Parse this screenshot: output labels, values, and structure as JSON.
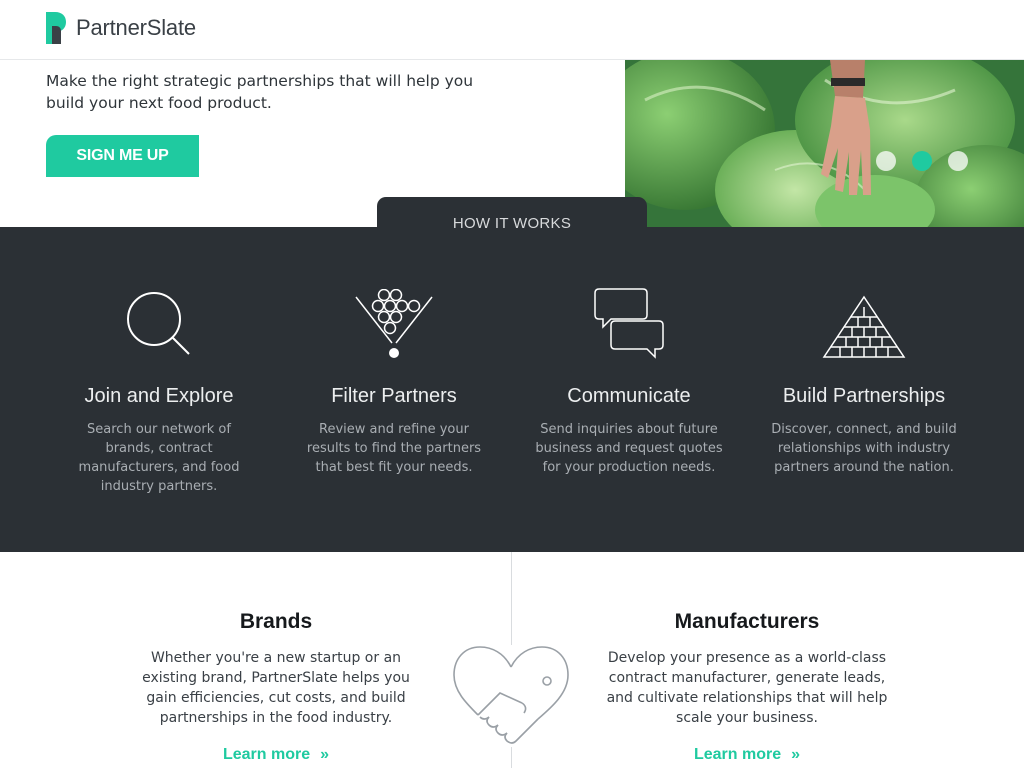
{
  "header": {
    "logo_text": "PartnerSlate"
  },
  "hero": {
    "tagline": "Make the right strategic partnerships that will help you build your next food product.",
    "cta_label": "SIGN ME UP",
    "carousel": {
      "slides": 3,
      "active_index": 1
    }
  },
  "how_it_works": {
    "tab_label": "HOW IT WORKS",
    "steps": [
      {
        "icon": "magnifier-icon",
        "title": "Join and Explore",
        "text": "Search our network of brands, contract manufacturers, and food industry partners."
      },
      {
        "icon": "funnel-filter-icon",
        "title": "Filter Partners",
        "text": "Review and refine your results to find the partners that best fit your needs."
      },
      {
        "icon": "chat-bubbles-icon",
        "title": "Communicate",
        "text": "Send inquiries about future business and request quotes for your production needs."
      },
      {
        "icon": "pyramid-icon",
        "title": "Build Partnerships",
        "text": "Discover, connect, and build relationships with industry partners around the nation."
      }
    ]
  },
  "audiences": {
    "brands": {
      "title": "Brands",
      "text": "Whether you're a new startup or an existing brand, PartnerSlate helps you gain efficiencies, cut costs, and build partnerships in the food industry.",
      "link": "Learn more",
      "link_suffix": "»"
    },
    "manufacturers": {
      "title": "Manufacturers",
      "text": "Develop your presence as a world-class contract manufacturer, generate leads, and cultivate relationships that will help scale your business.",
      "link": "Learn more",
      "link_suffix": "»"
    },
    "center_icon": "handshake-heart-icon"
  },
  "colors": {
    "accent": "#1fcaa0",
    "dark": "#2b3035",
    "muted_text": "#a9aeb3"
  }
}
